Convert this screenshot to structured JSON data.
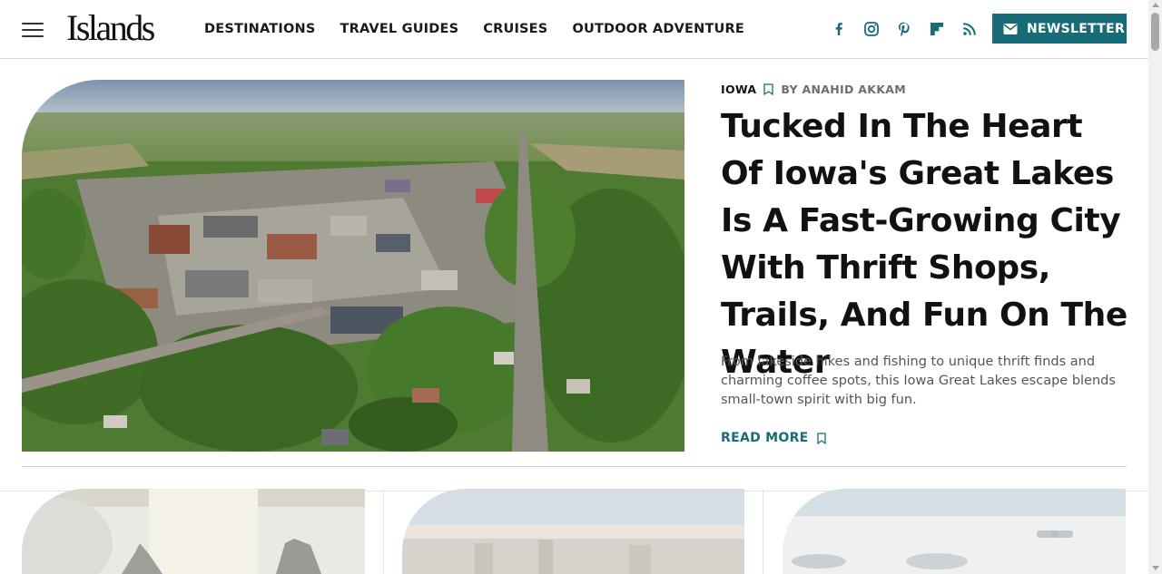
{
  "site": {
    "logo_text": "Islands"
  },
  "nav": {
    "items": [
      {
        "label": "DESTINATIONS"
      },
      {
        "label": "TRAVEL GUIDES"
      },
      {
        "label": "CRUISES"
      },
      {
        "label": "OUTDOOR ADVENTURE"
      }
    ]
  },
  "social": {
    "icons": [
      "facebook-icon",
      "instagram-icon",
      "pinterest-icon",
      "flipboard-icon",
      "rss-icon"
    ]
  },
  "newsletter": {
    "label": "NEWSLETTER",
    "icon": "envelope-icon"
  },
  "featured": {
    "category": "IOWA",
    "byline": "BY ANAHID AKKAM",
    "headline": "Tucked In The Heart Of Iowa's Great Lakes Is A Fast-Growing City With Thrift Shops, Trails, And Fun On The Water",
    "summary": "From lakeside hikes and fishing to unique thrift finds and charming coffee spots, this Iowa Great Lakes escape blends small-town spirit with big fun.",
    "read_more": "READ MORE"
  },
  "colors": {
    "accent": "#186c77",
    "text": "#111111",
    "muted": "#6e6e6e"
  }
}
